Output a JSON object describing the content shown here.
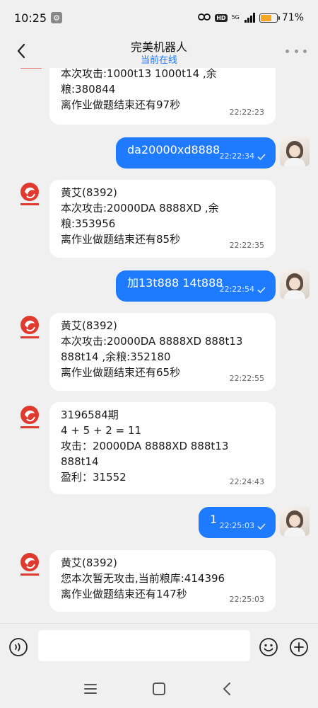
{
  "status_bar": {
    "time": "10:25",
    "network_label": "5G",
    "hd_label": "HD",
    "battery_percent": 71,
    "battery_text": "71%"
  },
  "header": {
    "title": "完美机器人",
    "subtitle": "当前在线"
  },
  "messages": [
    {
      "side": "in",
      "lines": [
        "本次攻击:1000t13 1000t14 ,余",
        "粮:380844",
        "离作业做题结束还有97秒"
      ],
      "time": "22:22:23"
    },
    {
      "side": "out",
      "lines": [
        "da20000xd8888"
      ],
      "time": "22:22:34"
    },
    {
      "side": "in",
      "lines": [
        "黄艾(8392)",
        "本次攻击:20000DA 8888XD ,余",
        "粮:353956",
        "离作业做题结束还有85秒"
      ],
      "time": "22:22:35"
    },
    {
      "side": "out",
      "lines": [
        "加13t888 14t888"
      ],
      "time": "22:22:54"
    },
    {
      "side": "in",
      "lines": [
        "黄艾(8392)",
        "本次攻击:20000DA 8888XD 888t13",
        "888t14 ,余粮:352180",
        "离作业做题结束还有65秒"
      ],
      "time": "22:22:55"
    },
    {
      "side": "in",
      "lines": [
        "3196584期",
        "4 + 5 + 2 = 11",
        "攻击：20000DA 8888XD 888t13",
        "888t14",
        "盈利：31552"
      ],
      "time": "22:24:43"
    },
    {
      "side": "out",
      "lines": [
        "1"
      ],
      "time": "22:25:03"
    },
    {
      "side": "in",
      "lines": [
        "黄艾(8392)",
        "您本次暂无攻击,当前粮库:414396",
        "离作业做题结束还有147秒"
      ],
      "time": "22:25:03"
    }
  ],
  "input": {
    "placeholder": ""
  },
  "icons": {
    "back": "chevron-left-icon",
    "more": "more-dots-icon",
    "voice": "voice-icon",
    "emoji": "emoji-icon",
    "plus": "plus-icon",
    "read": "check-icon"
  },
  "colors": {
    "outgoing_bubble": "#1e7bff",
    "incoming_bubble": "#ffffff",
    "subtitle": "#1677ff",
    "battery": "#f5a623"
  }
}
